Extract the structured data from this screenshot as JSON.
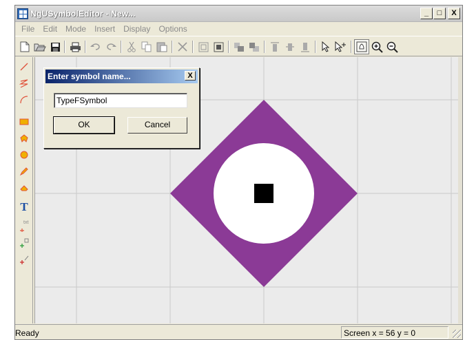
{
  "window": {
    "title": "NgUSymbolEditor - New...",
    "controls": [
      "_",
      "□",
      "X"
    ]
  },
  "menu": [
    "File",
    "Edit",
    "Mode",
    "Insert",
    "Display",
    "Options"
  ],
  "toolbar": {
    "icons": [
      "new-file-icon",
      "open-folder-icon",
      "save-icon",
      "print-icon",
      "undo-icon",
      "redo-icon",
      "cut-icon",
      "copy-icon",
      "paste-icon",
      "delete-icon",
      "group-icon",
      "ungroup-icon",
      "bring-to-front-icon",
      "send-to-back-icon",
      "align-top-icon",
      "align-middle-icon",
      "align-bottom-icon",
      "select-arrow-icon",
      "select-points-icon",
      "pan-icon",
      "zoom-in-icon",
      "zoom-out-icon"
    ]
  },
  "left_tools": [
    "line-icon",
    "polyline-icon",
    "arc-icon",
    "rectangle-icon",
    "polygon-icon",
    "circle-icon",
    "pencil-icon",
    "fill-icon",
    "text-tool-icon",
    "text-anchor-icon",
    "port-icon",
    "connection-point-icon"
  ],
  "left_tool_labels": {
    "text_tool": "T",
    "text_anchor": "txt"
  },
  "colors": {
    "diamond": "#8b3a96",
    "circle": "#ffffff",
    "square": "#000000",
    "canvas_bg": "#ebebeb",
    "grid": "#c9c9c9",
    "dialog_title": "#0a246a"
  },
  "dialog": {
    "title": "Enter symbol name...",
    "close": "X",
    "input_value": "TypeFSymbol",
    "ok_label": "OK",
    "cancel_label": "Cancel"
  },
  "status": {
    "left": "Ready",
    "right": "Screen  x = 56  y = 0"
  }
}
